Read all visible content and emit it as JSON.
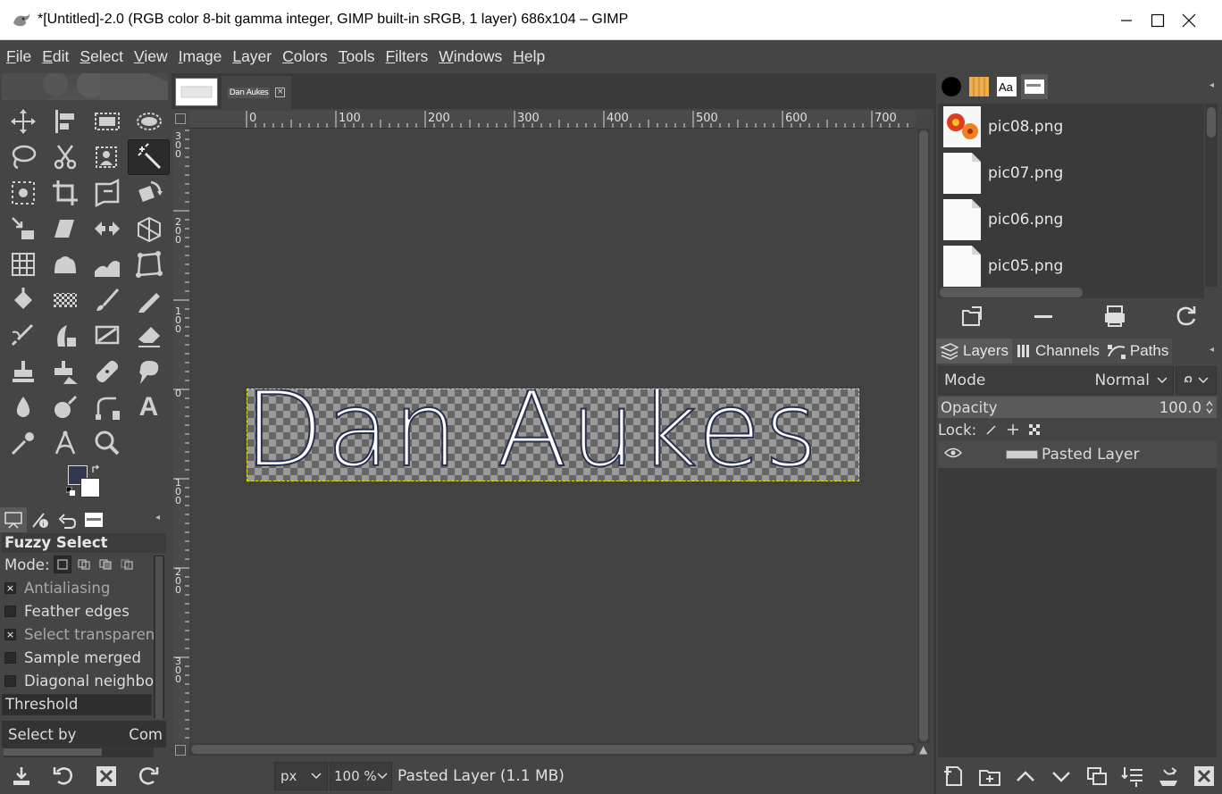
{
  "window": {
    "title": "*[Untitled]-2.0 (RGB color 8-bit gamma integer, GIMP built-in sRGB, 1 layer) 686x104 – GIMP",
    "minimize_icon": "minimize-icon",
    "maximize_icon": "maximize-icon",
    "close_icon": "close-icon"
  },
  "menubar": {
    "items": [
      "File",
      "Edit",
      "Select",
      "View",
      "Image",
      "Layer",
      "Colors",
      "Tools",
      "Filters",
      "Windows",
      "Help"
    ]
  },
  "toolbox": {
    "tools": [
      "move-tool",
      "align-tool",
      "rect-select-tool",
      "ellipse-select-tool",
      "free-select-tool",
      "scissors-select-tool",
      "foreground-select-tool",
      "fuzzy-select-tool",
      "by-color-select-tool",
      "crop-tool",
      "unified-transform-tool",
      "rotate-tool",
      "scale-tool",
      "shear-tool",
      "flip-tool",
      "perspective-tool",
      "cage-transform-tool",
      "warp-tool",
      "handle-transform-tool",
      "3d-transform-tool",
      "bucket-fill-tool",
      "gradient-tool",
      "paintbrush-tool",
      "pencil-tool",
      "airbrush-tool",
      "ink-tool",
      "mypaint-brush-tool",
      "eraser-tool",
      "clone-tool",
      "perspective-clone-tool",
      "heal-tool",
      "smudge-tool",
      "blur-tool",
      "dodge-burn-tool",
      "paths-tool",
      "text-tool",
      "color-picker-tool",
      "measure-tool",
      "zoom-tool",
      ""
    ],
    "active_tool_index": 7,
    "fg_color": "#2f3850",
    "bg_color": "#ffffff"
  },
  "tool_options": {
    "title": "Fuzzy Select",
    "mode_label": "Mode:",
    "options": [
      {
        "label": "Antialiasing",
        "checked": true,
        "dim": true
      },
      {
        "label": "Feather edges",
        "checked": false,
        "dim": false
      },
      {
        "label": "Select transparen",
        "checked": true,
        "dim": true
      },
      {
        "label": "Sample merged",
        "checked": false,
        "dim": false
      },
      {
        "label": "Diagonal neighbo",
        "checked": false,
        "dim": false
      }
    ],
    "threshold_label": "Threshold",
    "select_by_label": "Select by",
    "select_by_value": "Com"
  },
  "image_window": {
    "tab_label": "Dan Aukes",
    "close_glyph": "×",
    "ruler_h": [
      "0",
      "100",
      "200",
      "300",
      "400",
      "500",
      "600",
      "700"
    ],
    "ruler_v": [
      "300",
      "200",
      "100",
      "0",
      "100",
      "200",
      "300"
    ],
    "canvas_text": "Dan Aukes",
    "unit": "px",
    "zoom": "100 %",
    "status": "Pasted Layer (1.1 MB)"
  },
  "images_panel": {
    "items": [
      "pic08.png",
      "pic07.png",
      "pic06.png",
      "pic05.png"
    ]
  },
  "layers_panel": {
    "tabs": [
      "Layers",
      "Channels",
      "Paths"
    ],
    "mode_label": "Mode",
    "mode_value": "Normal",
    "opacity_label": "Opacity",
    "opacity_value": "100.0",
    "lock_label": "Lock:",
    "layer_name": "Pasted Layer"
  }
}
